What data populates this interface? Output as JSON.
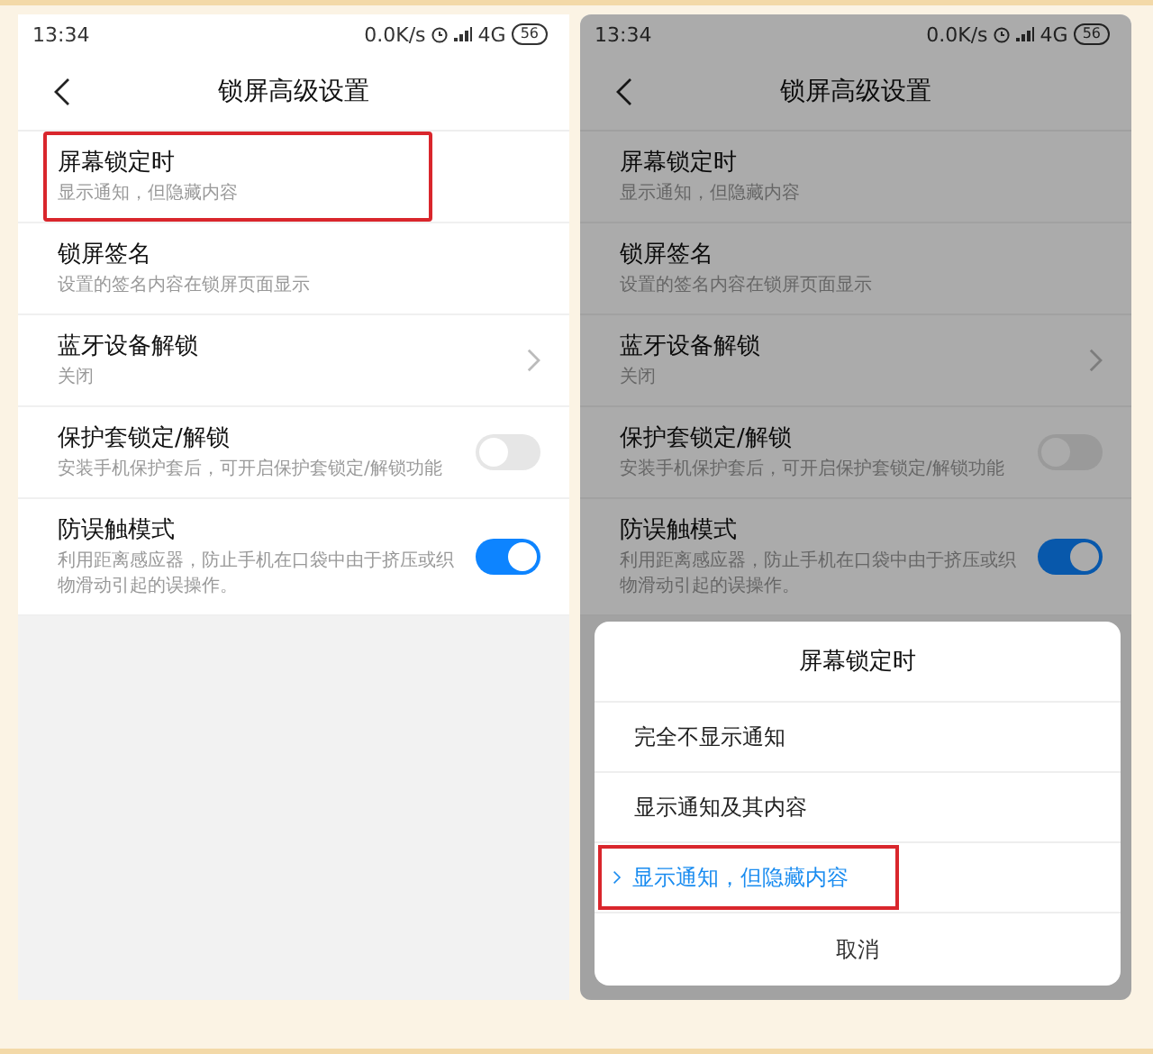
{
  "screens": [
    {
      "status_bar": {
        "time": "13:34",
        "speed": "0.0K/s",
        "network": "4G",
        "battery": "56"
      },
      "title": "锁屏高级设置",
      "dimmed": false,
      "items": [
        {
          "kind": "plain",
          "title": "屏幕锁定时",
          "subtitle": "显示通知，但隐藏内容",
          "highlighted": true
        },
        {
          "kind": "plain",
          "title": "锁屏签名",
          "subtitle": "设置的签名内容在锁屏页面显示",
          "highlighted": false
        },
        {
          "kind": "link",
          "title": "蓝牙设备解锁",
          "subtitle": "关闭",
          "highlighted": false
        },
        {
          "kind": "switch",
          "title": "保护套锁定/解锁",
          "subtitle": "安装手机保护套后，可开启保护套锁定/解锁功能",
          "on": false,
          "highlighted": false
        },
        {
          "kind": "switch",
          "title": "防误触模式",
          "subtitle": "利用距离感应器，防止手机在口袋中由于挤压或织物滑动引起的误操作。",
          "on": true,
          "highlighted": false
        }
      ]
    },
    {
      "status_bar": {
        "time": "13:34",
        "speed": "0.0K/s",
        "network": "4G",
        "battery": "56"
      },
      "title": "锁屏高级设置",
      "dimmed": true,
      "items": [
        {
          "kind": "plain",
          "title": "屏幕锁定时",
          "subtitle": "显示通知，但隐藏内容",
          "highlighted": false
        },
        {
          "kind": "plain",
          "title": "锁屏签名",
          "subtitle": "设置的签名内容在锁屏页面显示",
          "highlighted": false
        },
        {
          "kind": "link",
          "title": "蓝牙设备解锁",
          "subtitle": "关闭",
          "highlighted": false
        },
        {
          "kind": "switch",
          "title": "保护套锁定/解锁",
          "subtitle": "安装手机保护套后，可开启保护套锁定/解锁功能",
          "on": false,
          "highlighted": false
        },
        {
          "kind": "switch",
          "title": "防误触模式",
          "subtitle": "利用距离感应器，防止手机在口袋中由于挤压或织物滑动引起的误操作。",
          "on": true,
          "highlighted": false
        }
      ],
      "dialog": {
        "title": "屏幕锁定时",
        "options": [
          {
            "label": "完全不显示通知",
            "selected": false,
            "highlighted": false
          },
          {
            "label": "显示通知及其内容",
            "selected": false,
            "highlighted": false
          },
          {
            "label": "显示通知，但隐藏内容",
            "selected": true,
            "highlighted": true
          }
        ],
        "cancel": "取消"
      }
    }
  ]
}
